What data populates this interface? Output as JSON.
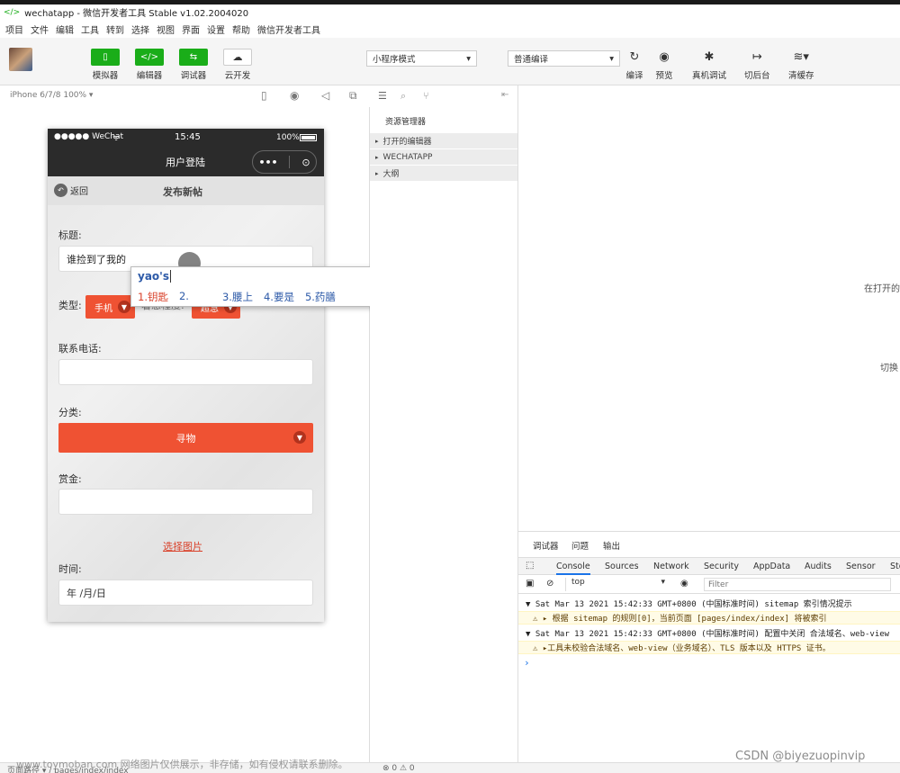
{
  "titlebar": {
    "title": "wechatapp - 微信开发者工具 Stable v1.02.2004020"
  },
  "menu": [
    "项目",
    "文件",
    "编辑",
    "工具",
    "转到",
    "选择",
    "视图",
    "界面",
    "设置",
    "帮助",
    "微信开发者工具"
  ],
  "toolbar": {
    "simulator": "模拟器",
    "editor": "编辑器",
    "debugger": "调试器",
    "cloud": "云开发",
    "mode_select": "小程序模式",
    "compile_select": "普通编译",
    "compile": "编译",
    "preview": "预览",
    "remote_debug": "真机调试",
    "background": "切后台",
    "clear_cache": "清缓存"
  },
  "simbar": {
    "device": "iPhone 6/7/8 100% ▾"
  },
  "phone": {
    "carrier": "●●●●● WeChat",
    "time": "15:45",
    "battery": "100%",
    "nav_title": "用户登陆",
    "back_label": "返回",
    "page_title": "发布新帖",
    "title_label": "标题:",
    "title_value": "谁捡到了我的",
    "type_label": "类型:",
    "type_value": "手机",
    "urgency_label": "着急程度:",
    "urgency_value": "超急",
    "phone_label": "联系电话:",
    "category_label": "分类:",
    "category_value": "寻物",
    "reward_label": "赏金:",
    "choose_image": "选择图片",
    "time_label": "时间:",
    "time_placeholder": "年 /月/日"
  },
  "ime": {
    "composition": "yao's",
    "candidates": [
      "1.钥匙",
      "2.",
      "3.腰上",
      "4.要是",
      "5.药膳"
    ]
  },
  "explorer": {
    "title": "资源管理器",
    "sections": [
      "打开的编辑器",
      "WECHATAPP",
      "大纲"
    ]
  },
  "editor": {
    "hint1": "在打开的",
    "hint2": "切换"
  },
  "devtools": {
    "panel_tabs": [
      "调试器",
      "问题",
      "输出"
    ],
    "tabs": [
      "Console",
      "Sources",
      "Network",
      "Security",
      "AppData",
      "Audits",
      "Sensor",
      "Sto"
    ],
    "context": "top",
    "filter_placeholder": "Filter",
    "logs": [
      "▼ Sat Mar 13 2021 15:42:33 GMT+0800 (中国标准时间) sitemap 索引情况提示",
      "⚠ ▸ 根据 sitemap 的规则[0]，当前页面 [pages/index/index] 将被索引",
      "▼ Sat Mar 13 2021 15:42:33 GMT+0800 (中国标准时间) 配置中关闭 合法域名、web-view",
      "⚠ ▸工具未校验合法域名、web-view（业务域名）、TLS 版本以及 HTTPS 证书。"
    ],
    "prompt": "›"
  },
  "statusbar": {
    "path": "页面路径 ▾ / pages/index/index",
    "counts": "⊗ 0 ⚠ 0"
  },
  "watermark": {
    "left": "www.toymoban.com 网络图片仅供展示，非存储，如有侵权请联系删除。",
    "right": "CSDN @biyezuopinvip"
  }
}
